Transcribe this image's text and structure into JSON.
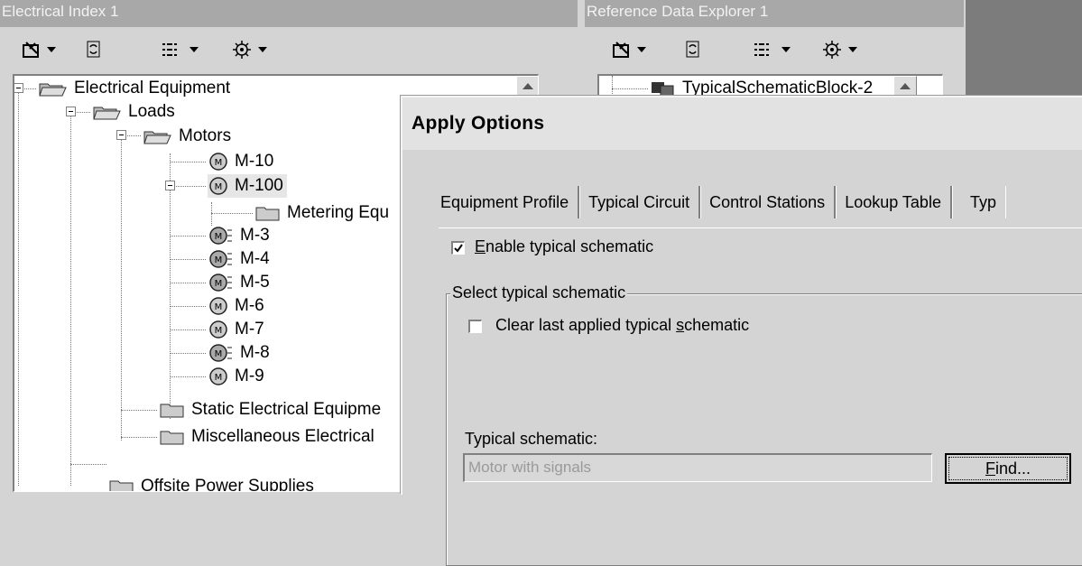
{
  "left_pane": {
    "title": "Electrical Index 1",
    "tree": {
      "root": "Electrical Equipment",
      "loads": "Loads",
      "motors": "Motors",
      "m10": "M-10",
      "m100": "M-100",
      "metering": "Metering Equ",
      "m3": "M-3",
      "m4": "M-4",
      "m5": "M-5",
      "m6": "M-6",
      "m7": "M-7",
      "m8": "M-8",
      "m9": "M-9",
      "static": "Static Electrical Equipme",
      "misc": "Miscellaneous Electrical",
      "offsite": "Offsite Power Supplies"
    }
  },
  "right_pane": {
    "title": "Reference Data Explorer 1",
    "tree": {
      "block": "TypicalSchematicBlock-2"
    }
  },
  "dialog": {
    "title": "Apply Options",
    "tabs": [
      "Equipment Profile",
      "Typical Circuit",
      "Control Stations",
      "Lookup Table",
      "Typ"
    ],
    "enable_prefix": "E",
    "enable_rest": "nable typical schematic",
    "enable_checked": true,
    "group_label": "Select typical schematic",
    "clear_pre": "Clear last applied typical ",
    "clear_u": "s",
    "clear_post": "chematic",
    "clear_checked": false,
    "schematic_label": "Typical schematic:",
    "schematic_value": "Motor with signals",
    "find_u": "F",
    "find_rest": "ind..."
  }
}
